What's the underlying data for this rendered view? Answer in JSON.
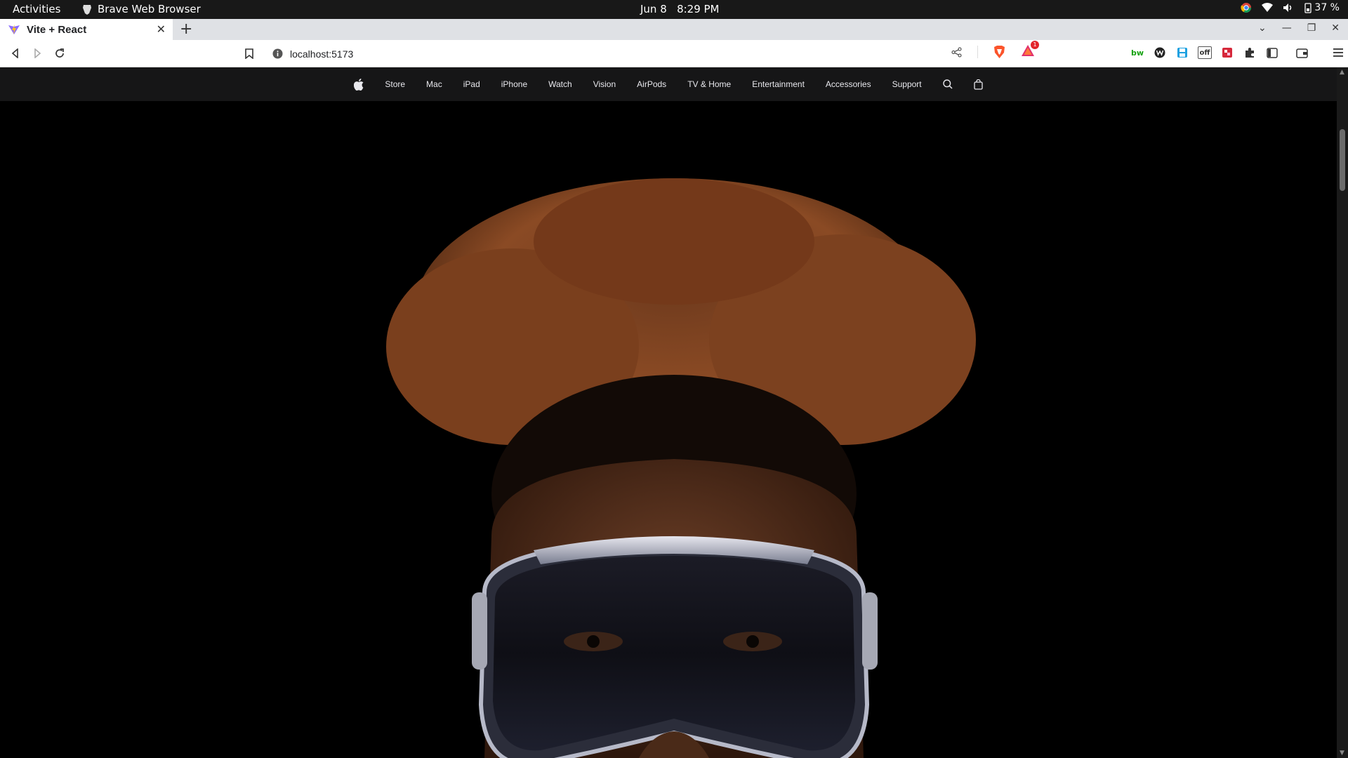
{
  "system_bar": {
    "activities": "Activities",
    "app_name": "Brave Web Browser",
    "clock_date": "Jun 8",
    "clock_time": "8:29 PM",
    "battery": "37 %"
  },
  "browser": {
    "tab_title": "Vite + React",
    "url": "localhost:5173",
    "shields_badge": "1"
  },
  "globalnav": {
    "items": [
      {
        "label": "Store"
      },
      {
        "label": "Mac"
      },
      {
        "label": "iPad"
      },
      {
        "label": "iPhone"
      },
      {
        "label": "Watch"
      },
      {
        "label": "Vision"
      },
      {
        "label": "AirPods"
      },
      {
        "label": "TV & Home"
      },
      {
        "label": "Entertainment"
      },
      {
        "label": "Accessories"
      },
      {
        "label": "Support"
      }
    ],
    "icons": [
      "apple-logo-icon",
      "search-icon",
      "shopping-bag-icon"
    ]
  },
  "hero": {
    "image": "Person with curly hair wearing Apple Vision Pro headset on black background",
    "colors": {
      "background": "#000000",
      "hair": "#8a4a24",
      "skin": "#5a3320"
    }
  }
}
